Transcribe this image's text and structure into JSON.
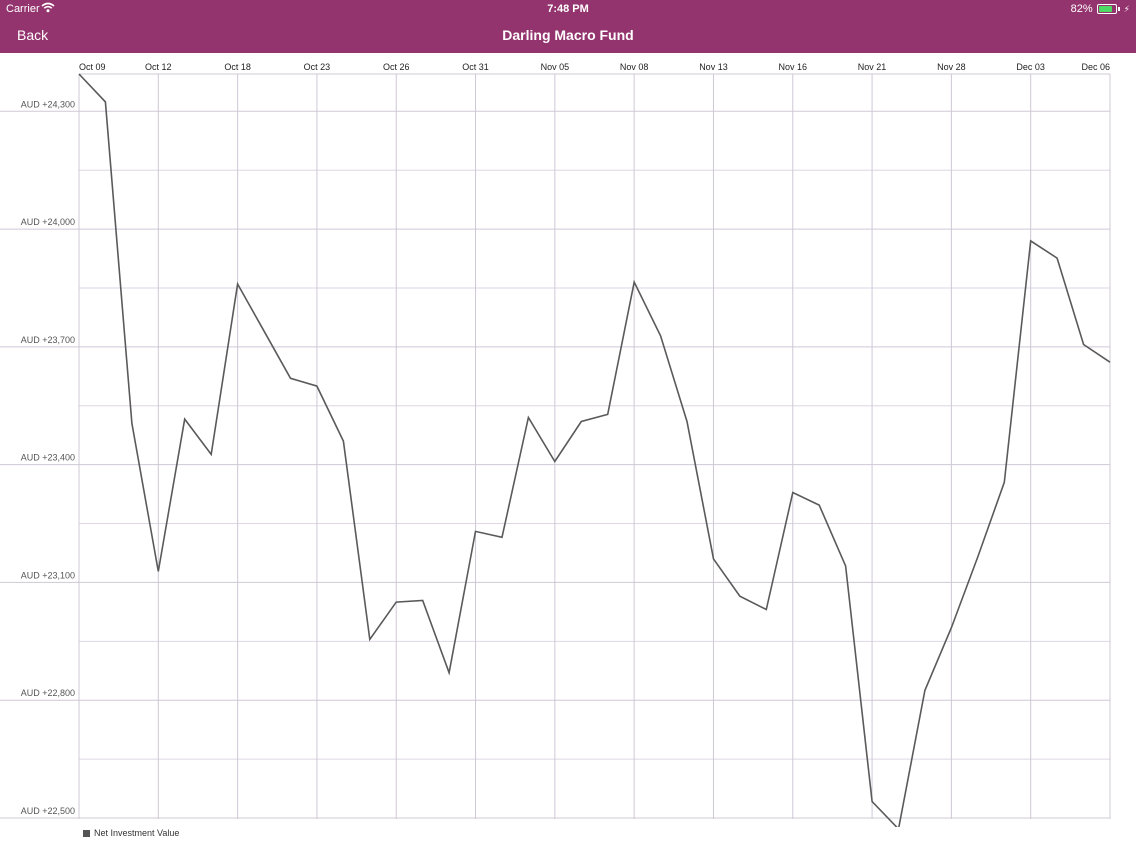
{
  "status_bar": {
    "carrier": "Carrier",
    "time": "7:48 PM",
    "battery": "82%",
    "battery_level": 0.82,
    "wifi_icon": "wifi-icon",
    "battery_icon": "battery-icon",
    "charging_icon": "charging-bolt-icon"
  },
  "nav": {
    "back_label": "Back",
    "title": "Darling Macro Fund",
    "bar_color": "#94346e"
  },
  "chart_data": {
    "type": "line",
    "title": "",
    "xlabel": "",
    "ylabel": "",
    "x_tick_labels": [
      "Oct 09",
      "Oct 12",
      "Oct 18",
      "Oct 23",
      "Oct 26",
      "Oct 31",
      "Nov 05",
      "Nov 08",
      "Nov 13",
      "Nov 16",
      "Nov 21",
      "Nov 28",
      "Dec 03",
      "Dec 06"
    ],
    "y_ticks": [
      22500,
      22800,
      23100,
      23400,
      23700,
      24000,
      24300
    ],
    "y_tick_labels": [
      "AUD +22,500",
      "AUD +22,800",
      "AUD +23,100",
      "AUD +23,400",
      "AUD +23,700",
      "AUD +24,000",
      "AUD +24,300"
    ],
    "ylim": [
      22500,
      24395
    ],
    "x_axis_position": "top",
    "grid": true,
    "legend_position": "bottom-left",
    "line_color": "#5a5a5a",
    "series": [
      {
        "name": "Net Investment Value",
        "values": [
          24395,
          24324,
          23505,
          23128,
          23516,
          23426,
          23860,
          23740,
          23620,
          23600,
          23460,
          22955,
          23050,
          23054,
          22870,
          23230,
          23215,
          23520,
          23408,
          23510,
          23528,
          23865,
          23728,
          23510,
          23160,
          23065,
          23031,
          23329,
          23297,
          23142,
          22542,
          22472,
          22825,
          22985,
          23165,
          23355,
          23970,
          23926,
          23706,
          23661
        ]
      }
    ]
  }
}
